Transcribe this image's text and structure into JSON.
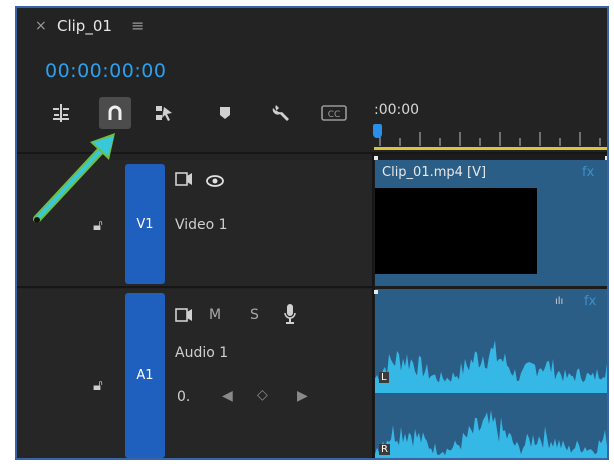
{
  "header": {
    "close_glyph": "×",
    "tab_title": "Clip_01",
    "menu_glyph": "≡",
    "timecode": "00:00:00:00"
  },
  "toolbar": {
    "tools": [
      {
        "name": "insert-overwrite-icon"
      },
      {
        "name": "snap-icon",
        "active": true
      },
      {
        "name": "linked-selection-icon"
      },
      {
        "name": "add-marker-icon"
      },
      {
        "name": "wrench-icon"
      },
      {
        "name": "captions-icon",
        "label": "CC"
      }
    ],
    "ruler_time": ":00:00"
  },
  "tracks": {
    "v1": {
      "id": "V1",
      "name": "Video 1",
      "clip_label": "Clip_01.mp4 [V]"
    },
    "a1": {
      "id": "A1",
      "name": "Audio 1",
      "mute": "M",
      "solo": "S",
      "keyframe_value": "0.",
      "channel_left": "L",
      "channel_right": "R"
    }
  },
  "colors": {
    "accent_blue": "#2aa0ee",
    "track_blue": "#1f5fbd",
    "clip_blue": "#2b5e86",
    "waveform": "#35b8e6",
    "ruler_yellow": "#d8c53a",
    "arrow_cyan": "#39c7dc",
    "arrow_green": "#6fbf3f"
  }
}
